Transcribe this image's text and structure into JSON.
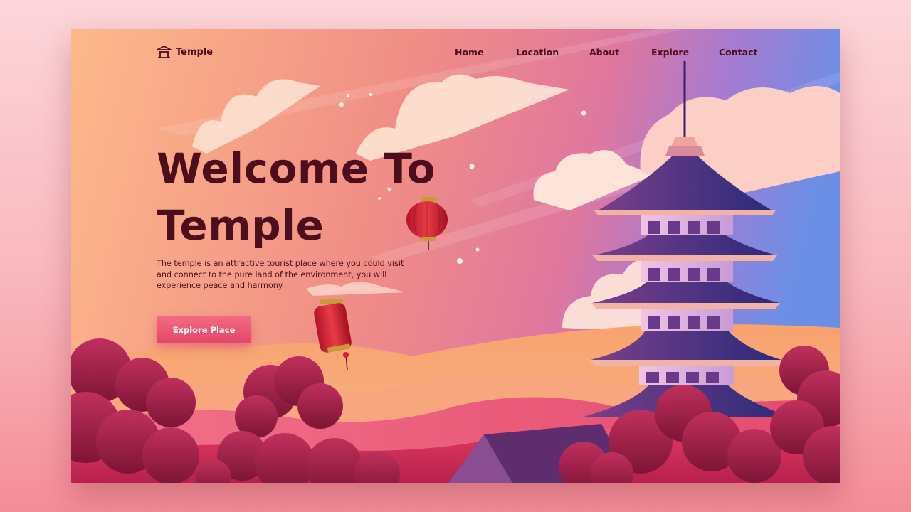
{
  "brand": {
    "name": "Temple",
    "icon": "temple-icon"
  },
  "nav": {
    "items": [
      {
        "label": "Home"
      },
      {
        "label": "Location"
      },
      {
        "label": "About"
      },
      {
        "label": "Explore"
      },
      {
        "label": "Contact"
      }
    ]
  },
  "hero": {
    "title_line1": "Welcome To",
    "title_line2": "Temple",
    "description": "The temple is an attractive tourist place where you could visit and connect to the pure land of the environment, you will experience peace and harmony.",
    "cta_label": "Explore Place"
  },
  "colors": {
    "text_dark": "#4e0d1d",
    "cta": "#e94b6d",
    "sky_left": "#fdb98a",
    "sky_right": "#6c8fe6",
    "pagoda_roof": "#3b1c6b",
    "trees": "#9b1a44"
  }
}
